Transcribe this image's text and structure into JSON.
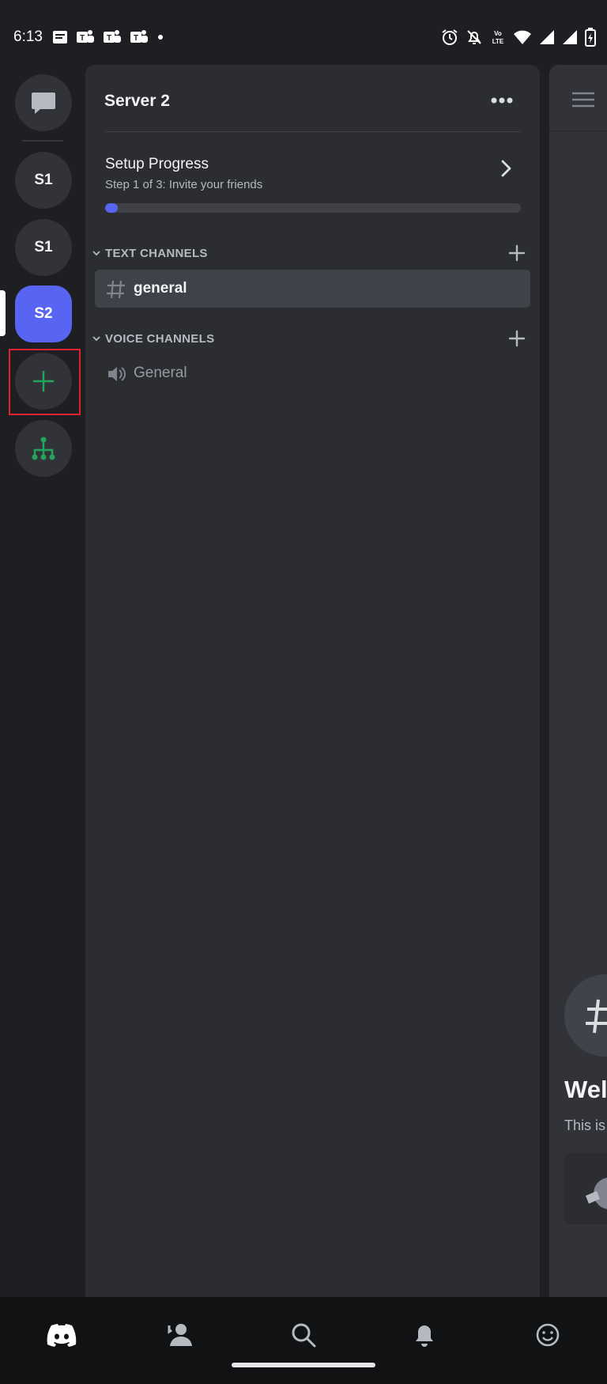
{
  "status_bar": {
    "time": "6:13",
    "left_icons": [
      "messages-icon",
      "teams-icon",
      "teams-icon",
      "teams-icon",
      "dot-icon"
    ],
    "right_icons": [
      "alarm-icon",
      "notifications-off-icon",
      "volte-icon",
      "wifi-icon",
      "signal-icon",
      "signal-icon",
      "battery-charging-icon"
    ]
  },
  "server_rail": {
    "items": [
      {
        "label": "",
        "icon": "direct-messages-icon"
      },
      {
        "label": "S1"
      },
      {
        "label": "S1"
      },
      {
        "label": "S2",
        "active": true
      },
      {
        "label": "",
        "icon": "add-server-icon"
      },
      {
        "label": "",
        "icon": "explore-servers-icon"
      }
    ]
  },
  "server_panel": {
    "title": "Server 2",
    "setup": {
      "title": "Setup Progress",
      "subtitle": "Step 1 of 3: Invite your friends",
      "progress_fraction": 0.03
    },
    "categories": [
      {
        "label": "TEXT CHANNELS",
        "channels": [
          {
            "label": "general",
            "type": "text",
            "selected": true
          }
        ]
      },
      {
        "label": "VOICE CHANNELS",
        "channels": [
          {
            "label": "General",
            "type": "voice",
            "selected": false
          }
        ]
      }
    ]
  },
  "chat_peek": {
    "welcome": "Wel",
    "subtitle": "This is"
  },
  "bottom_nav": {
    "items": [
      "discord-home-icon",
      "friends-icon",
      "search-icon",
      "notifications-icon",
      "profile-icon"
    ]
  },
  "colors": {
    "accent": "#5865f2",
    "green": "#23a559",
    "highlight": "#e0242e"
  }
}
